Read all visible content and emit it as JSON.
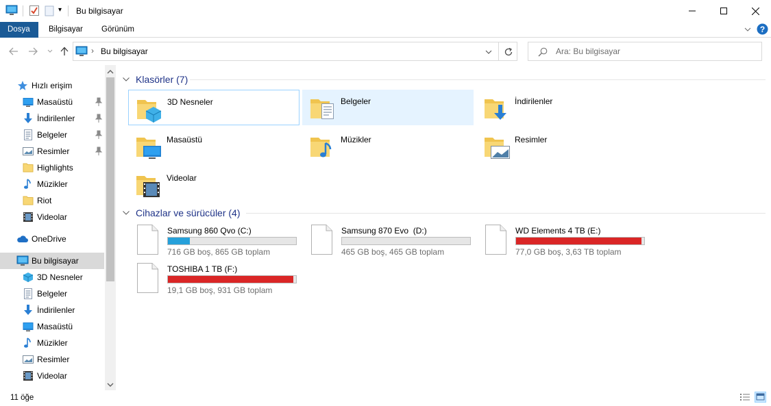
{
  "window": {
    "title": "Bu bilgisayar",
    "quick_access_dropdown": "▾"
  },
  "ribbon": {
    "tabs": [
      {
        "label": "Dosya",
        "active": true
      },
      {
        "label": "Bilgisayar",
        "active": false
      },
      {
        "label": "Görünüm",
        "active": false
      }
    ]
  },
  "address": {
    "separator": "›",
    "location": "Bu bilgisayar"
  },
  "search": {
    "placeholder": "Ara: Bu bilgisayar"
  },
  "sidebar": {
    "quick_access": {
      "label": "Hızlı erişim"
    },
    "quick_items": [
      {
        "label": "Masaüstü",
        "icon": "desktop-icon",
        "pinned": true
      },
      {
        "label": "İndirilenler",
        "icon": "download-icon",
        "pinned": true
      },
      {
        "label": "Belgeler",
        "icon": "documents-icon",
        "pinned": true
      },
      {
        "label": "Resimler",
        "icon": "pictures-icon",
        "pinned": true
      },
      {
        "label": "Highlights",
        "icon": "folder-icon",
        "pinned": false
      },
      {
        "label": "Müzikler",
        "icon": "music-icon",
        "pinned": false
      },
      {
        "label": "Riot",
        "icon": "folder-icon",
        "pinned": false
      },
      {
        "label": "Videolar",
        "icon": "videos-icon",
        "pinned": false
      }
    ],
    "onedrive": {
      "label": "OneDrive"
    },
    "this_pc": {
      "label": "Bu bilgisayar"
    },
    "pc_items": [
      {
        "label": "3D Nesneler",
        "icon": "3d-objects-icon"
      },
      {
        "label": "Belgeler",
        "icon": "documents-icon"
      },
      {
        "label": "İndirilenler",
        "icon": "download-icon"
      },
      {
        "label": "Masaüstü",
        "icon": "desktop-icon"
      },
      {
        "label": "Müzikler",
        "icon": "music-icon"
      },
      {
        "label": "Resimler",
        "icon": "pictures-icon"
      },
      {
        "label": "Videolar",
        "icon": "videos-icon"
      }
    ]
  },
  "main": {
    "folders_group": {
      "title": "Klasörler (7)"
    },
    "folders": [
      {
        "label": "3D Nesneler",
        "icon": "3d-objects-folder-icon"
      },
      {
        "label": "Belgeler",
        "icon": "documents-folder-icon"
      },
      {
        "label": "İndirilenler",
        "icon": "downloads-folder-icon"
      },
      {
        "label": "Masaüstü",
        "icon": "desktop-folder-icon"
      },
      {
        "label": "Müzikler",
        "icon": "music-folder-icon"
      },
      {
        "label": "Resimler",
        "icon": "pictures-folder-icon"
      },
      {
        "label": "Videolar",
        "icon": "videos-folder-icon"
      }
    ],
    "drives_group": {
      "title": "Cihazlar ve sürücüler (4)"
    },
    "drives": [
      {
        "name": "Samsung 860 Qvo (C:)",
        "info": "716 GB boş, 865 GB toplam",
        "used_fraction": 0.17,
        "bar_color": "#26a0da"
      },
      {
        "name": "Samsung 870 Evo  (D:)",
        "info": "465 GB boş, 465 GB toplam",
        "used_fraction": 0.0,
        "bar_color": "#26a0da"
      },
      {
        "name": "WD Elements 4 TB (E:)",
        "info": "77,0 GB boş, 3,63 TB toplam",
        "used_fraction": 0.98,
        "bar_color": "#da2626"
      },
      {
        "name": "TOSHIBA 1 TB (F:)",
        "info": "19,1 GB boş, 931 GB toplam",
        "used_fraction": 0.98,
        "bar_color": "#da2626"
      }
    ]
  },
  "status": {
    "item_count": "11 öğe"
  },
  "colors": {
    "accent": "#1a5a96",
    "group_title": "#1e3287",
    "selection": "#e5f3ff",
    "help": "#1c6ec2"
  }
}
